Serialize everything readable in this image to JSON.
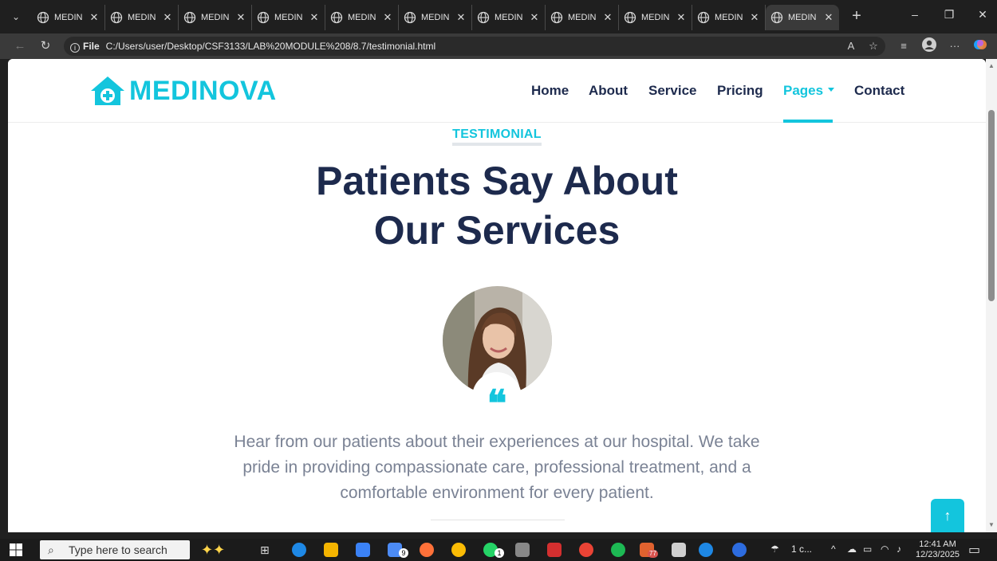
{
  "browser": {
    "tabs": [
      {
        "label": "MEDIN",
        "active": false
      },
      {
        "label": "MEDIN",
        "active": false
      },
      {
        "label": "MEDIN",
        "active": false
      },
      {
        "label": "MEDIN",
        "active": false
      },
      {
        "label": "MEDIN",
        "active": false
      },
      {
        "label": "MEDIN",
        "active": false
      },
      {
        "label": "MEDIN",
        "active": false
      },
      {
        "label": "MEDIN",
        "active": false
      },
      {
        "label": "MEDIN",
        "active": false
      },
      {
        "label": "MEDIN",
        "active": false
      },
      {
        "label": "MEDIN",
        "active": true
      }
    ],
    "address": {
      "scheme_label": "File",
      "url": "C:/Users/user/Desktop/CSF3133/LAB%20MODULE%208/8.7/testimonial.html"
    }
  },
  "site": {
    "brand": "MEDINOVA",
    "nav": {
      "home": "Home",
      "about": "About",
      "service": "Service",
      "pricing": "Pricing",
      "pages": "Pages",
      "contact": "Contact"
    },
    "accent_color": "#13C5DD",
    "heading_color": "#1D2A4D"
  },
  "testimonial": {
    "eyebrow": "TESTIMONIAL",
    "heading_line1": "Patients Say About",
    "heading_line2": "Our Services",
    "quote_mark": "❝",
    "text": "Hear from our patients about their experiences at our hospital. We take pride in providing compassionate care, professional treatment, and a comfortable environment for every patient."
  },
  "back_to_top": "↑",
  "taskbar": {
    "search_placeholder": "Type here to search",
    "weather": "1 c...",
    "time": "12:41 AM",
    "date": "12/23/2025",
    "badges": {
      "mail": "9",
      "whatsapp": "1",
      "telegram": "77"
    }
  }
}
